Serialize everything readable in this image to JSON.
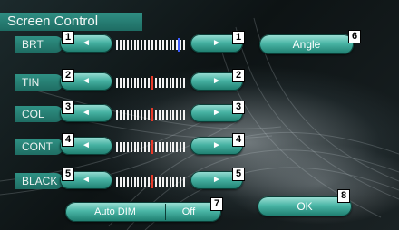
{
  "title": "Screen Control",
  "rows": [
    {
      "label": "BRT",
      "left_arrow": "◄",
      "right_arrow": "►",
      "callout": "1",
      "level": 0.9,
      "pointer_color": "#3d5cff"
    },
    {
      "label": "TIN",
      "left_arrow": "◄",
      "right_arrow": "►",
      "callout": "2",
      "level": 0.5,
      "pointer_color": "#e83a2a"
    },
    {
      "label": "COL",
      "left_arrow": "◄",
      "right_arrow": "►",
      "callout": "3",
      "level": 0.5,
      "pointer_color": "#e83a2a"
    },
    {
      "label": "CONT",
      "left_arrow": "◄",
      "right_arrow": "►",
      "callout": "4",
      "level": 0.5,
      "pointer_color": "#e83a2a"
    },
    {
      "label": "BLACK",
      "left_arrow": "◄",
      "right_arrow": "►",
      "callout": "5",
      "level": 0.5,
      "pointer_color": "#e83a2a"
    }
  ],
  "angle_button": {
    "label": "Angle",
    "callout": "6"
  },
  "auto_dim": {
    "label": "Auto DIM",
    "value": "Off",
    "callout": "7"
  },
  "ok_button": {
    "label": "OK",
    "callout": "8"
  },
  "colors": {
    "accent": "#2f8e83",
    "button": "#47b3a3",
    "slider_tick": "#f2f2f2"
  }
}
